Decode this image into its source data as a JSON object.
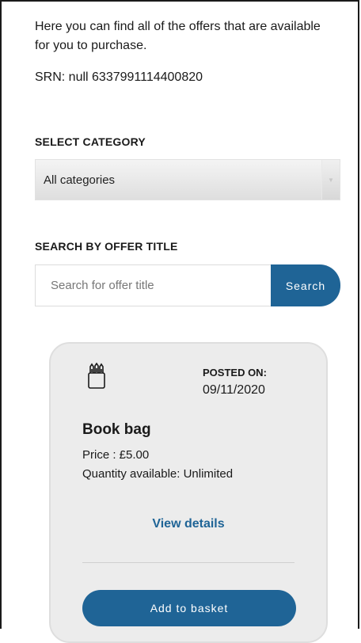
{
  "intro": {
    "text": "Here you can find all of the offers that are available for you to purchase.",
    "srn": "SRN: null 6337991114400820"
  },
  "category": {
    "label": "SELECT CATEGORY",
    "selected": "All categories",
    "arrow_icon": "chevron-down-icon"
  },
  "search": {
    "label": "SEARCH BY OFFER TITLE",
    "placeholder": "Search for offer title",
    "value": "",
    "button_label": "Search"
  },
  "offer": {
    "icon": "pencil-cup-icon",
    "posted_label": "POSTED ON:",
    "posted_date": "09/11/2020",
    "title": "Book bag",
    "price": "Price : £5.00",
    "quantity": "Quantity available: Unlimited",
    "view_details": "View details",
    "add_to_basket": "Add to basket"
  },
  "colors": {
    "accent": "#1f6496",
    "card_bg": "#ececec"
  }
}
